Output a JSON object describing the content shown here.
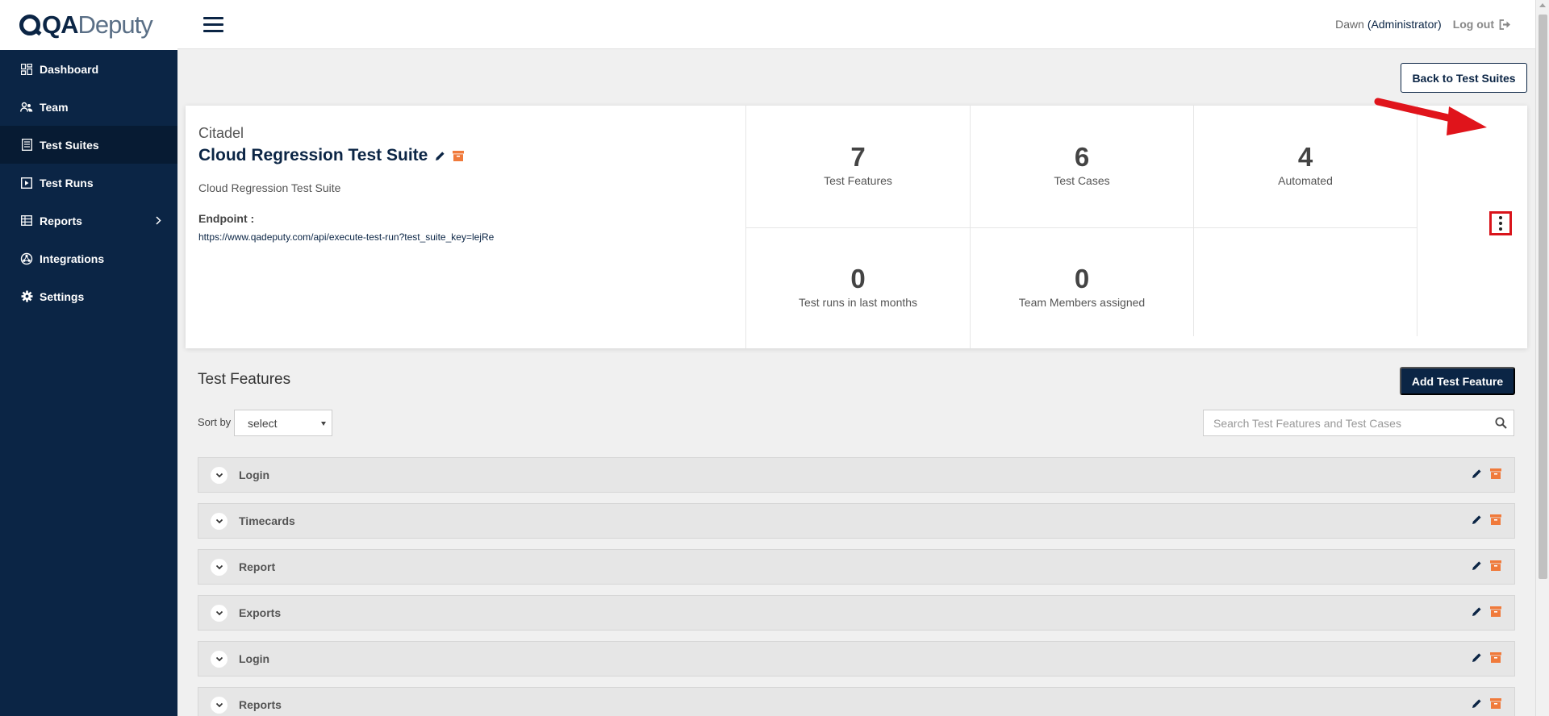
{
  "brand": {
    "logo_bold": "QA",
    "logo_light": "Deputy"
  },
  "sidebar": {
    "items": [
      {
        "label": "Dashboard",
        "icon": "dashboard-icon"
      },
      {
        "label": "Team",
        "icon": "team-icon"
      },
      {
        "label": "Test Suites",
        "icon": "test-suites-icon",
        "active": true
      },
      {
        "label": "Test Runs",
        "icon": "test-runs-icon"
      },
      {
        "label": "Reports",
        "icon": "reports-icon",
        "has_submenu": true
      },
      {
        "label": "Integrations",
        "icon": "integrations-icon"
      },
      {
        "label": "Settings",
        "icon": "settings-icon"
      }
    ]
  },
  "header": {
    "user_name": "Dawn",
    "user_role": "(Administrator)",
    "logout_label": "Log out"
  },
  "actions": {
    "back_label": "Back to Test Suites"
  },
  "suite": {
    "project": "Citadel",
    "title": "Cloud Regression Test Suite",
    "description": "Cloud Regression Test Suite",
    "endpoint_label": "Endpoint :",
    "endpoint_url": "https://www.qadeputy.com/api/execute-test-run?test_suite_key=lejRe"
  },
  "stats": {
    "features": {
      "value": "7",
      "label": "Test Features"
    },
    "cases": {
      "value": "6",
      "label": "Test Cases"
    },
    "automated": {
      "value": "4",
      "label": "Automated"
    },
    "runs": {
      "value": "0",
      "label": "Test runs in last months"
    },
    "members": {
      "value": "0",
      "label": "Team Members assigned"
    }
  },
  "features_section": {
    "title": "Test Features",
    "add_label": "Add Test Feature",
    "sort_label": "Sort by",
    "sort_value": "select",
    "search_placeholder": "Search Test Features and Test Cases",
    "items": [
      {
        "name": "Login"
      },
      {
        "name": "Timecards"
      },
      {
        "name": "Report"
      },
      {
        "name": "Exports"
      },
      {
        "name": "Login"
      },
      {
        "name": "Reports"
      }
    ]
  },
  "colors": {
    "navy": "#0b2545",
    "archive_orange": "#f07a3b",
    "highlight_red": "#d9141b"
  }
}
